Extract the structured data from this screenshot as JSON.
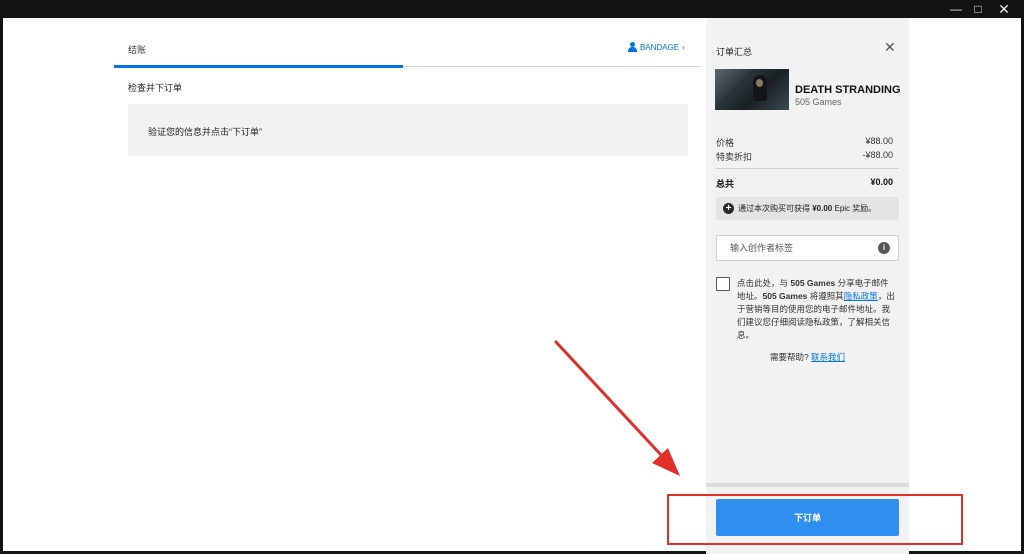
{
  "window": {
    "minimize_glyph": "—",
    "maximize_glyph": "□",
    "close_glyph": "✕"
  },
  "checkout": {
    "tab_label": "结账",
    "user_name": "BANDAGE",
    "user_chevron": "›",
    "section_title": "检查并下订单",
    "verify_message": "验证您的信息并点击“下订单”"
  },
  "order_summary": {
    "title": "订单汇总",
    "close_glyph": "✕",
    "game": {
      "name": "DEATH STRANDING",
      "publisher": "505 Games"
    },
    "price_label": "价格",
    "price_value": "¥88.00",
    "discount_label": "特卖折扣",
    "discount_value": "-¥88.00",
    "total_label": "总共",
    "total_value": "¥0.00",
    "reward_icon": "+",
    "reward_prefix": "通过本次购买可获得 ",
    "reward_amount": "¥0.00",
    "reward_suffix": " Epic 奖励。",
    "creator_tag_placeholder": "输入创作者标签",
    "info_glyph": "i",
    "consent": {
      "part1": "点击此处，与 ",
      "publisher1": "505 Games",
      "part2": " 分享电子邮件地址。",
      "publisher2": "505 Games",
      "part3": " 将遵照其",
      "privacy_link": "隐私政策",
      "part4": "，出于营销等目的使用您的电子邮件地址。我们建议您仔细阅读隐私政策，了解相关信息。"
    },
    "help_text": "需要帮助?",
    "contact_link": "联系我们",
    "place_order_label": "下订单"
  },
  "colors": {
    "accent": "#0074e4",
    "button": "#2f8ff0",
    "annotation": "#e0302a",
    "panel": "#f2f2f2"
  }
}
